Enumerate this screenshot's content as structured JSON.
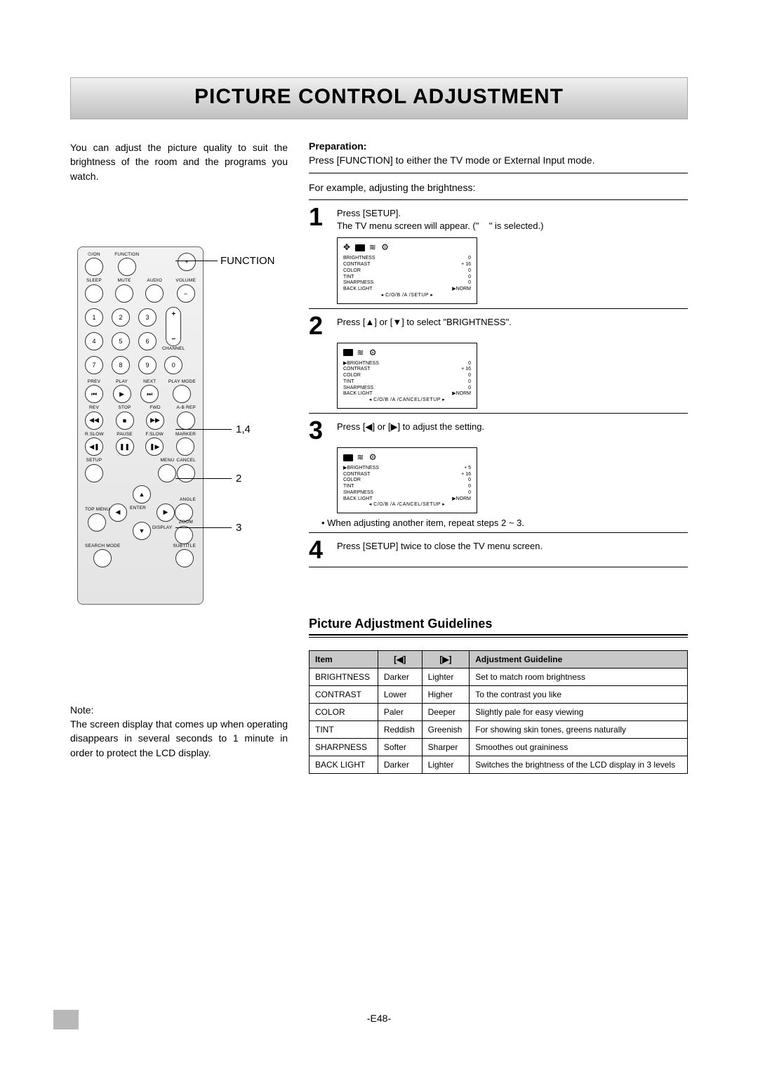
{
  "title": "PICTURE CONTROL ADJUSTMENT",
  "intro": "You can adjust the picture quality to suit the brightness of the room and the programs you watch.",
  "preparation_label": "Preparation:",
  "preparation_text": "Press [FUNCTION] to either the TV mode or External Input mode.",
  "example_text": "For example, adjusting the brightness:",
  "annotations": {
    "function": "FUNCTION",
    "a14": "1,4",
    "a2": "2",
    "a3": "3"
  },
  "steps": [
    {
      "num": "1",
      "line1": "Press [SETUP].",
      "line2": "The TV menu screen will appear. (\"    \" is selected.)"
    },
    {
      "num": "2",
      "line1": "Press [▲] or [▼] to select \"BRIGHTNESS\"."
    },
    {
      "num": "3",
      "line1": "Press [◀] or [▶] to adjust the setting."
    },
    {
      "num": "4",
      "line1": "Press [SETUP] twice to close the TV menu screen."
    }
  ],
  "after_step3_note": "• When adjusting another item, repeat steps 2 ~ 3.",
  "osd": {
    "items": [
      {
        "label": "BRIGHTNESS",
        "val": "0"
      },
      {
        "label": "CONTRAST",
        "val": "+ 16"
      },
      {
        "label": "COLOR",
        "val": "0"
      },
      {
        "label": "TINT",
        "val": "0"
      },
      {
        "label": "SHARPNESS",
        "val": "0"
      },
      {
        "label": "BACK LIGHT",
        "val": "▶NORM"
      }
    ],
    "footer1": "◂ C/O/B /A /SETUP ▸",
    "footer2": "◂ C/O/B /A /CANCEL/SETUP ▸",
    "brightness_adj": "+ 5",
    "icons_row": "✦"
  },
  "guidelines_heading": "Picture Adjustment Guidelines",
  "guide_headers": {
    "item": "Item",
    "left": "[◀]",
    "right": "[▶]",
    "guideline": "Adjustment Guideline"
  },
  "guide_rows": [
    {
      "item": "BRIGHTNESS",
      "l": "Darker",
      "r": "Lighter",
      "g": "Set to match room brightness"
    },
    {
      "item": "CONTRAST",
      "l": "Lower",
      "r": "Higher",
      "g": "To the contrast you like"
    },
    {
      "item": "COLOR",
      "l": "Paler",
      "r": "Deeper",
      "g": "Slightly pale for easy viewing"
    },
    {
      "item": "TINT",
      "l": "Reddish",
      "r": "Greenish",
      "g": "For showing skin tones, greens naturally"
    },
    {
      "item": "SHARPNESS",
      "l": "Softer",
      "r": "Sharper",
      "g": "Smoothes out graininess"
    },
    {
      "item": "BACK LIGHT",
      "l": "Darker",
      "r": "Lighter",
      "g": "Switches the brightness of the LCD display in 3 levels"
    }
  ],
  "note_label": "Note:",
  "note_text": "The screen display that comes up when operating disappears in several seconds to 1 minute in order to protect the LCD display.",
  "page_number": "-E48-",
  "remote": {
    "power": "⏻/ON",
    "function": "FUNCTION",
    "sleep": "SLEEP",
    "mute": "MUTE",
    "audio": "AUDIO",
    "volume": "VOLUME",
    "channel": "CHANNEL",
    "nums": [
      "1",
      "2",
      "3",
      "4",
      "5",
      "6",
      "7",
      "8",
      "9",
      "0"
    ],
    "prev": "PREV",
    "play": "PLAY",
    "next": "NEXT",
    "playmode": "PLAY MODE",
    "rev": "REV",
    "stop": "STOP",
    "fwd": "FWD",
    "abrep": "A-B REP",
    "rslow": "R.SLOW",
    "pause": "PAUSE",
    "fslow": "F.SLOW",
    "marker": "MARKER",
    "setup": "SETUP",
    "menu": "MENU",
    "cancel": "CANCEL",
    "enter": "ENTER",
    "angle": "ANGLE",
    "topmenu": "TOP MENU",
    "display": "DISPLAY",
    "zoom": "ZOOM",
    "searchmode": "SEARCH MODE",
    "subtitle": "SUBTITLE",
    "plus": "+",
    "minus": "–"
  }
}
